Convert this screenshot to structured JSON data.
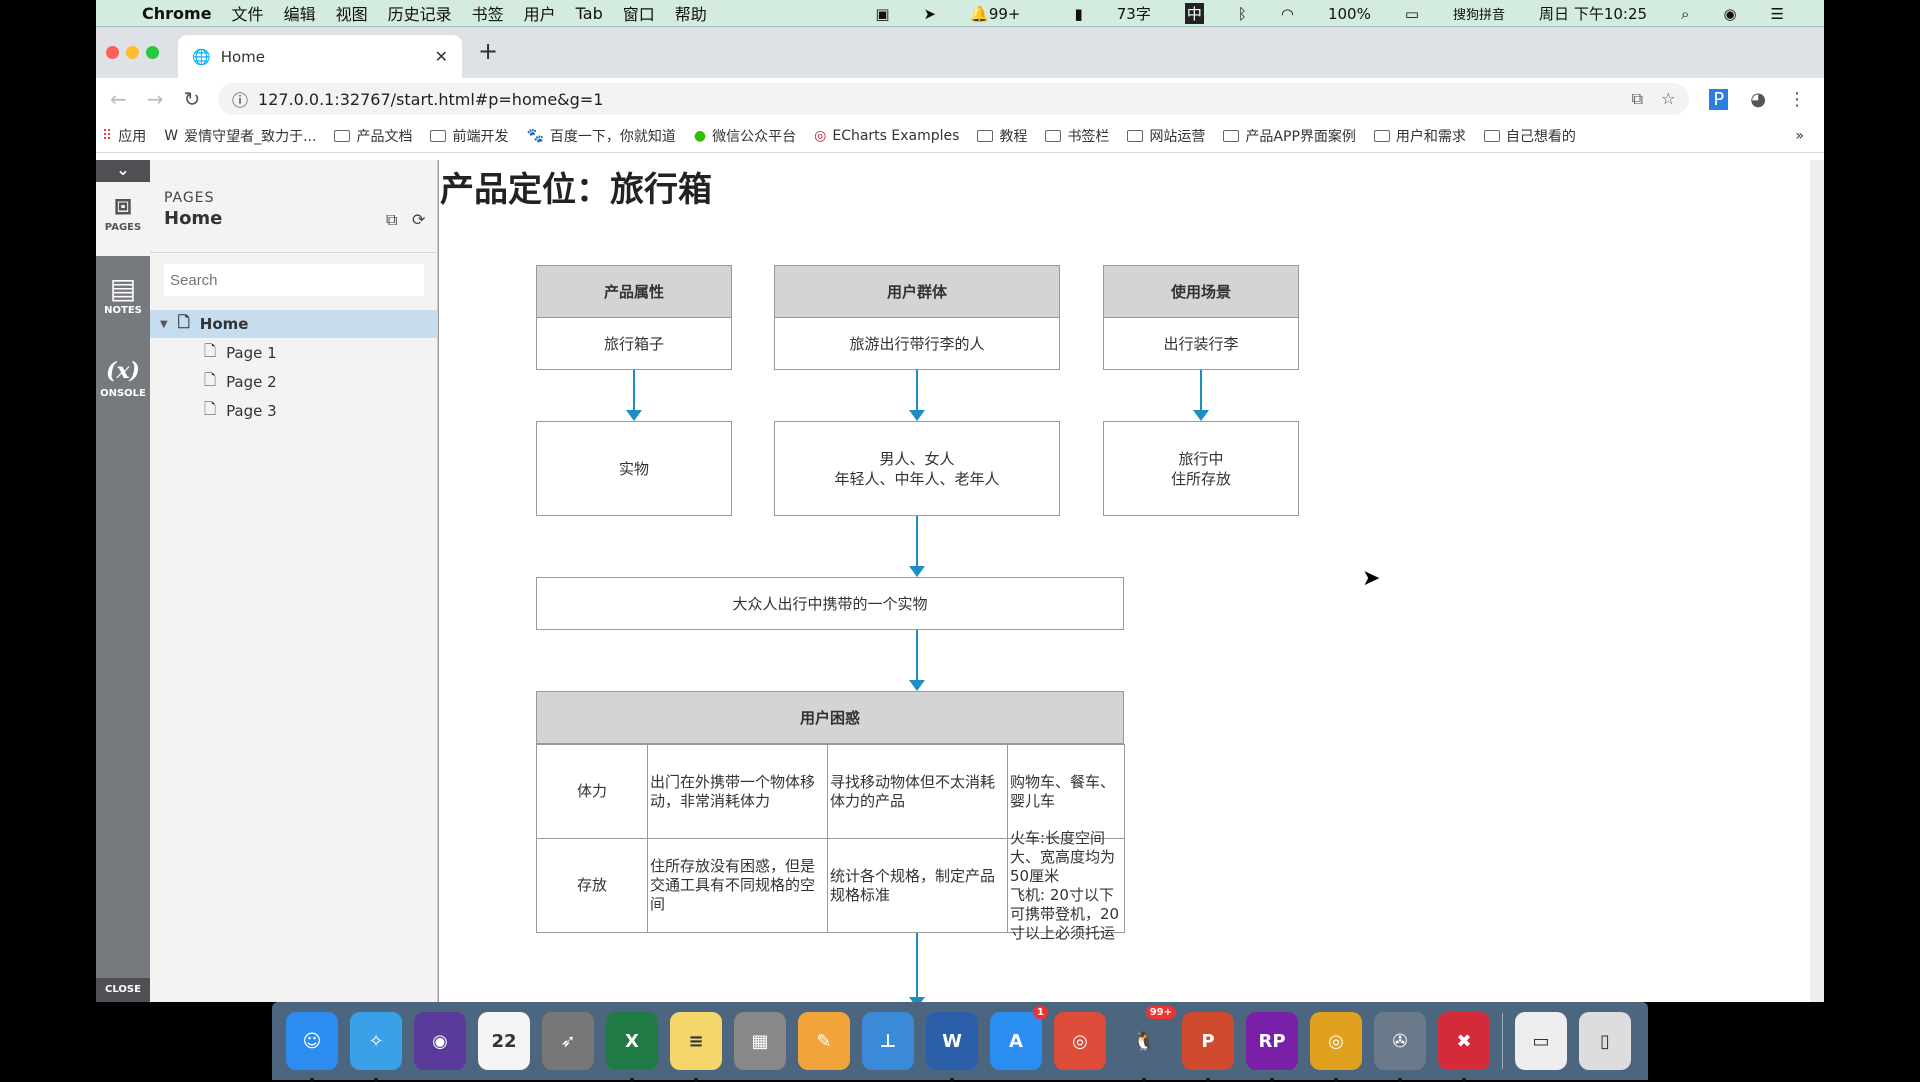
{
  "menubar": {
    "apple": "",
    "app": "Chrome",
    "items": [
      "文件",
      "编辑",
      "视图",
      "历史记录",
      "书签",
      "用户",
      "Tab",
      "窗口",
      "帮助"
    ],
    "status": {
      "qq": "99+",
      "chars": "73字",
      "ime_cn": "中",
      "battery": "100%",
      "ime": "搜狗拼音",
      "clock": "周日 下午10:25"
    }
  },
  "browser": {
    "tab_title": "Home",
    "url": "127.0.0.1:32767/start.html#p=home&g=1",
    "bookmarks": [
      {
        "label": "应用",
        "icon": "apps-grid"
      },
      {
        "label": "爱情守望者_致力于...",
        "icon": "w-logo"
      },
      {
        "label": "产品文档",
        "icon": "folder"
      },
      {
        "label": "前端开发",
        "icon": "folder"
      },
      {
        "label": "百度一下，你就知道",
        "icon": "baidu-paw"
      },
      {
        "label": "微信公众平台",
        "icon": "wechat"
      },
      {
        "label": "ECharts Examples",
        "icon": "echarts"
      },
      {
        "label": "教程",
        "icon": "folder"
      },
      {
        "label": "书签栏",
        "icon": "folder"
      },
      {
        "label": "网站运营",
        "icon": "folder"
      },
      {
        "label": "产品APP界面案例",
        "icon": "folder"
      },
      {
        "label": "用户和需求",
        "icon": "folder"
      },
      {
        "label": "自己想看的",
        "icon": "folder"
      }
    ],
    "more": "»"
  },
  "axure": {
    "iconbar": {
      "pages": "PAGES",
      "notes": "NOTES",
      "console_glyph": "(x)",
      "console": "ONSOLE",
      "close": "CLOSE"
    },
    "panel": {
      "section": "PAGES",
      "current": "Home",
      "search_placeholder": "Search",
      "tree": [
        {
          "label": "Home",
          "level": 0,
          "selected": true
        },
        {
          "label": "Page 1",
          "level": 1
        },
        {
          "label": "Page 2",
          "level": 1
        },
        {
          "label": "Page 3",
          "level": 1
        }
      ]
    }
  },
  "page": {
    "title": "产品定位：旅行箱",
    "columns": [
      {
        "header": "产品属性",
        "value": "旅行箱子",
        "result": [
          "实物"
        ]
      },
      {
        "header": "用户群体",
        "value": "旅游出行带行李的人",
        "result": [
          "男人、女人",
          "年轻人、中年人、老年人"
        ]
      },
      {
        "header": "使用场景",
        "value": "出行装行李",
        "result": [
          "旅行中",
          "住所存放"
        ]
      }
    ],
    "summary": "大众人出行中携带的一个实物",
    "pain": {
      "header": "用户困惑",
      "rows": [
        {
          "name": "体力",
          "problem": "出门在外携带一个物体移动，非常消耗体力",
          "idea": "寻找移动物体但不太消耗体力的产品",
          "ref": "购物车、餐车、婴儿车"
        },
        {
          "name": "存放",
          "problem": "住所存放没有困惑，但是交通工具有不同规格的空间",
          "idea": "统计各个规格，制定产品规格标准",
          "ref": "火车:长度空间大、宽高度均为50厘米\n飞机: 20寸以下可携带登机，20寸以上必须托运"
        }
      ]
    }
  },
  "dock": [
    {
      "name": "finder",
      "glyph": "☺",
      "color": "#2d8cf0",
      "running": true
    },
    {
      "name": "safari",
      "glyph": "✧",
      "color": "#3aa0e8",
      "running": true
    },
    {
      "name": "siri",
      "glyph": "◉",
      "color": "#5a3a9a"
    },
    {
      "name": "calendar",
      "glyph": "22",
      "color": "#f4f4f4"
    },
    {
      "name": "launchpad",
      "glyph": "➶",
      "color": "#777"
    },
    {
      "name": "excel",
      "glyph": "X",
      "color": "#1f7a45",
      "running": true
    },
    {
      "name": "notes",
      "glyph": "≡",
      "color": "#f5d66b",
      "running": true
    },
    {
      "name": "calculator",
      "glyph": "▦",
      "color": "#888"
    },
    {
      "name": "pages",
      "glyph": "✎",
      "color": "#f0a43a"
    },
    {
      "name": "keynote",
      "glyph": "⊥",
      "color": "#3b8ad8"
    },
    {
      "name": "word",
      "glyph": "W",
      "color": "#2b5faa",
      "running": true
    },
    {
      "name": "app-store",
      "glyph": "A",
      "color": "#2a8ff0",
      "badge": "1"
    },
    {
      "name": "chrome",
      "glyph": "◎",
      "color": "#dd4b39"
    },
    {
      "name": "qq",
      "glyph": "🐧",
      "color": "transparent",
      "badge": "99+",
      "running": true
    },
    {
      "name": "powerpoint",
      "glyph": "P",
      "color": "#d04a2f",
      "running": true
    },
    {
      "name": "axure-rp",
      "glyph": "RP",
      "color": "#7a1fa8",
      "running": true
    },
    {
      "name": "chrome-2",
      "glyph": "◎",
      "color": "#e0a020",
      "running": true
    },
    {
      "name": "video-editor",
      "glyph": "✇",
      "color": "#6a7a8a",
      "running": true
    },
    {
      "name": "xmind",
      "glyph": "✖",
      "color": "#d42a3a",
      "running": true
    },
    {
      "name": "screenshot-doc",
      "glyph": "▭",
      "color": "#eee"
    },
    {
      "name": "trash",
      "glyph": "▯",
      "color": "#ddd"
    }
  ]
}
